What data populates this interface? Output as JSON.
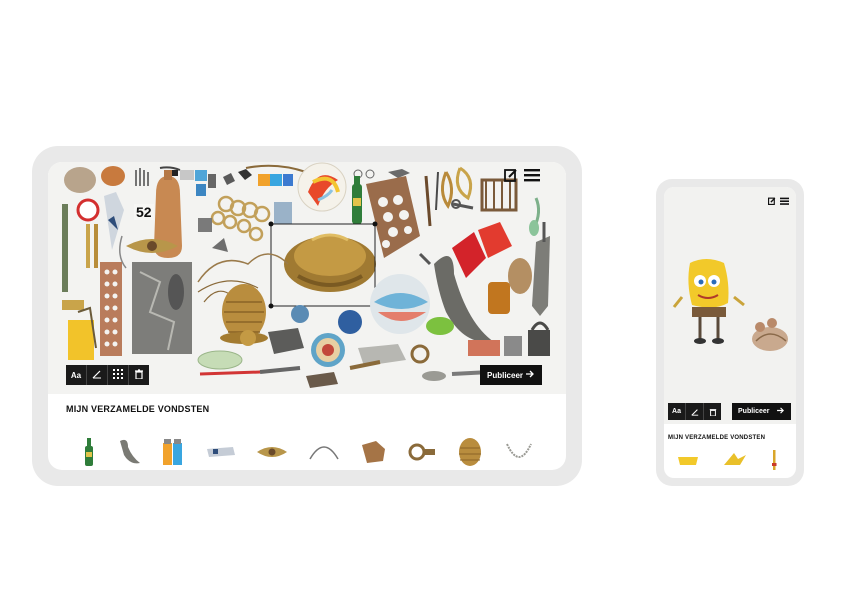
{
  "tablet": {
    "toolbar": {
      "text_label": "Aa",
      "pen_icon": "pen-icon",
      "grid_icon": "grid-icon",
      "trash_icon": "trash-icon"
    },
    "publish_label": "Publiceer",
    "publish_icon": "arrow-right-icon",
    "section_title": "MIJN VERZAMELDE VONDSTEN",
    "canvas_text": "52",
    "icons": {
      "edit": "edit-icon",
      "menu": "menu-icon"
    },
    "thumbs": [
      "green-bottle",
      "bird-figurine",
      "lighters",
      "pipe-fragment",
      "bronze-eye",
      "wire-arc",
      "shell-fragment",
      "buckle",
      "thimble",
      "chain-necklace"
    ]
  },
  "phone": {
    "toolbar": {
      "text_label": "Aa",
      "pen_icon": "pen-icon",
      "trash_icon": "trash-icon"
    },
    "publish_label": "Publiceer",
    "publish_icon": "arrow-right-icon",
    "section_title": "MIJN VERZAMELDE VONDSTEN",
    "icons": {
      "edit": "edit-icon",
      "menu": "menu-icon"
    },
    "thumbs": [
      "yellow-sponge",
      "yellow-star",
      "yellow-stick"
    ]
  },
  "colors": {
    "dark": "#111111",
    "frame": "#e9e9e9",
    "canvas": "#f3f3f1"
  }
}
